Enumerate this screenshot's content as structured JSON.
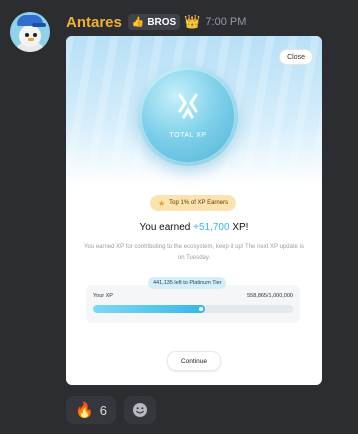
{
  "message": {
    "username": "Antares",
    "tag": {
      "icon": "thumbs-up-icon",
      "label": "BROS"
    },
    "crown_icon": "crown-icon",
    "timestamp": "7:00 PM",
    "username_color": "#f0b232"
  },
  "card": {
    "close_label": "Close",
    "coin_label": "TOTAL XP",
    "badge_label": "Top 1% of XP Earners",
    "earned_prefix": "You earned",
    "earned_amount": "+51,700",
    "earned_suffix": "XP!",
    "description": "You earned XP for contributing to the ecosystem, keep it up! The next XP update is on Tuesday.",
    "tier_text": "441,135 left to Platinum Tier",
    "xp_label": "Your XP",
    "xp_value": "558,865/1,000,000",
    "progress_fraction": 0.559,
    "continue_label": "Continue",
    "accent": "#38b6e8"
  },
  "reactions": [
    {
      "emoji": "🔥",
      "count": "6"
    }
  ],
  "add_reaction_icon": "smiley-icon"
}
